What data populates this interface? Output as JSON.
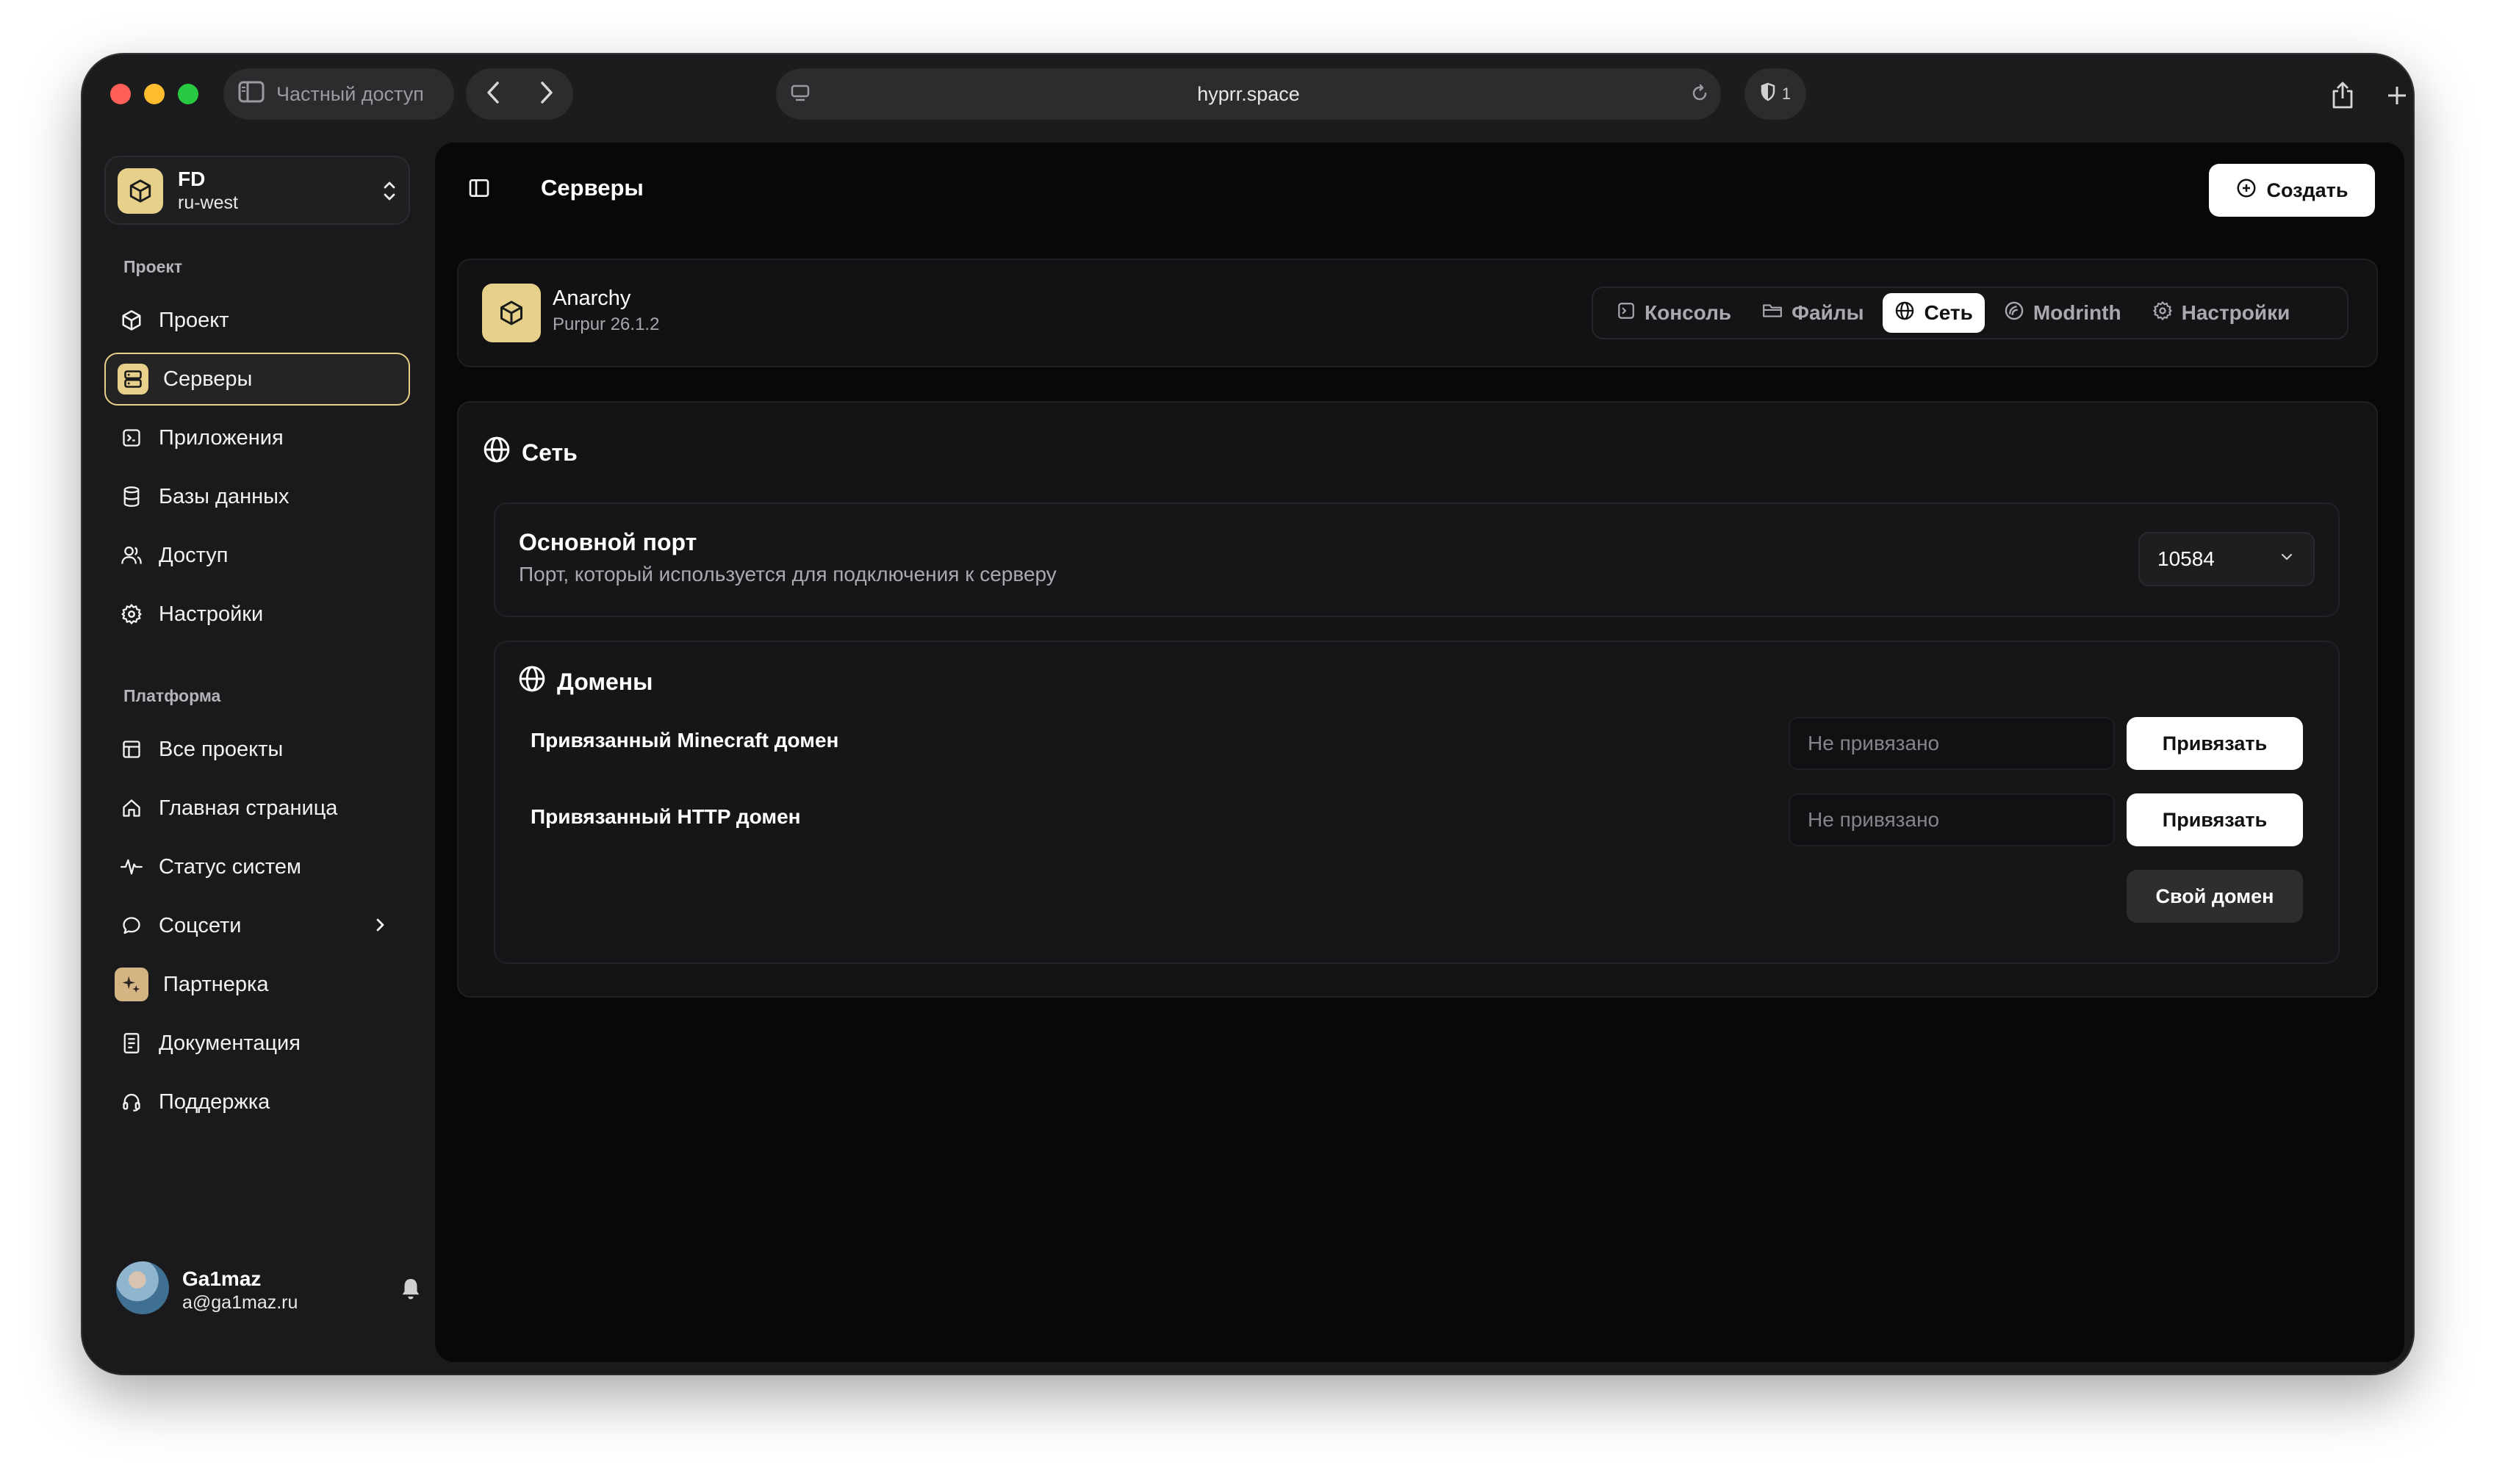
{
  "browser": {
    "private_label": "Частный доступ",
    "url": "hyprr.space",
    "shield_count": "1"
  },
  "sidebar": {
    "team": {
      "name": "FD",
      "region": "ru-west"
    },
    "project_section": "Проект",
    "project_items": [
      {
        "label": "Проект",
        "icon": "box-icon"
      },
      {
        "label": "Серверы",
        "icon": "server-icon",
        "active": true
      },
      {
        "label": "Приложения",
        "icon": "terminal-icon"
      },
      {
        "label": "Базы данных",
        "icon": "database-icon"
      },
      {
        "label": "Доступ",
        "icon": "users-icon"
      },
      {
        "label": "Настройки",
        "icon": "gear-icon"
      }
    ],
    "platform_section": "Платформа",
    "platform_items": [
      {
        "label": "Все проекты",
        "icon": "grid-icon"
      },
      {
        "label": "Главная страница",
        "icon": "home-icon"
      },
      {
        "label": "Статус систем",
        "icon": "activity-icon"
      },
      {
        "label": "Соцсети",
        "icon": "chat-icon"
      },
      {
        "label": "Партнерка",
        "icon": "sparkle-icon"
      },
      {
        "label": "Документация",
        "icon": "book-icon"
      },
      {
        "label": "Поддержка",
        "icon": "headset-icon"
      }
    ],
    "user": {
      "name": "Ga1maz",
      "email": "a@ga1maz.ru"
    }
  },
  "header": {
    "title": "Серверы",
    "create_label": "Создать"
  },
  "server": {
    "name": "Anarchy",
    "version": "Purpur 26.1.2",
    "tabs": [
      {
        "label": "Консоль",
        "icon": "console-icon"
      },
      {
        "label": "Файлы",
        "icon": "folder-icon"
      },
      {
        "label": "Сеть",
        "icon": "globe-icon",
        "active": true
      },
      {
        "label": "Modrinth",
        "icon": "modrinth-icon"
      },
      {
        "label": "Настройки",
        "icon": "gear-icon"
      }
    ]
  },
  "network": {
    "title": "Сеть",
    "port": {
      "title": "Основной порт",
      "description": "Порт, который используется для подключения к серверу",
      "value": "10584"
    },
    "domains": {
      "title": "Домены",
      "minecraft_label": "Привязанный Minecraft домен",
      "http_label": "Привязанный HTTP домен",
      "placeholder": "Не привязано",
      "bind_label": "Привязать",
      "own_domain_label": "Свой домен"
    }
  },
  "colors": {
    "accent": "#e6d08a",
    "background": "#080809",
    "sidebar": "#1a1a1c"
  }
}
